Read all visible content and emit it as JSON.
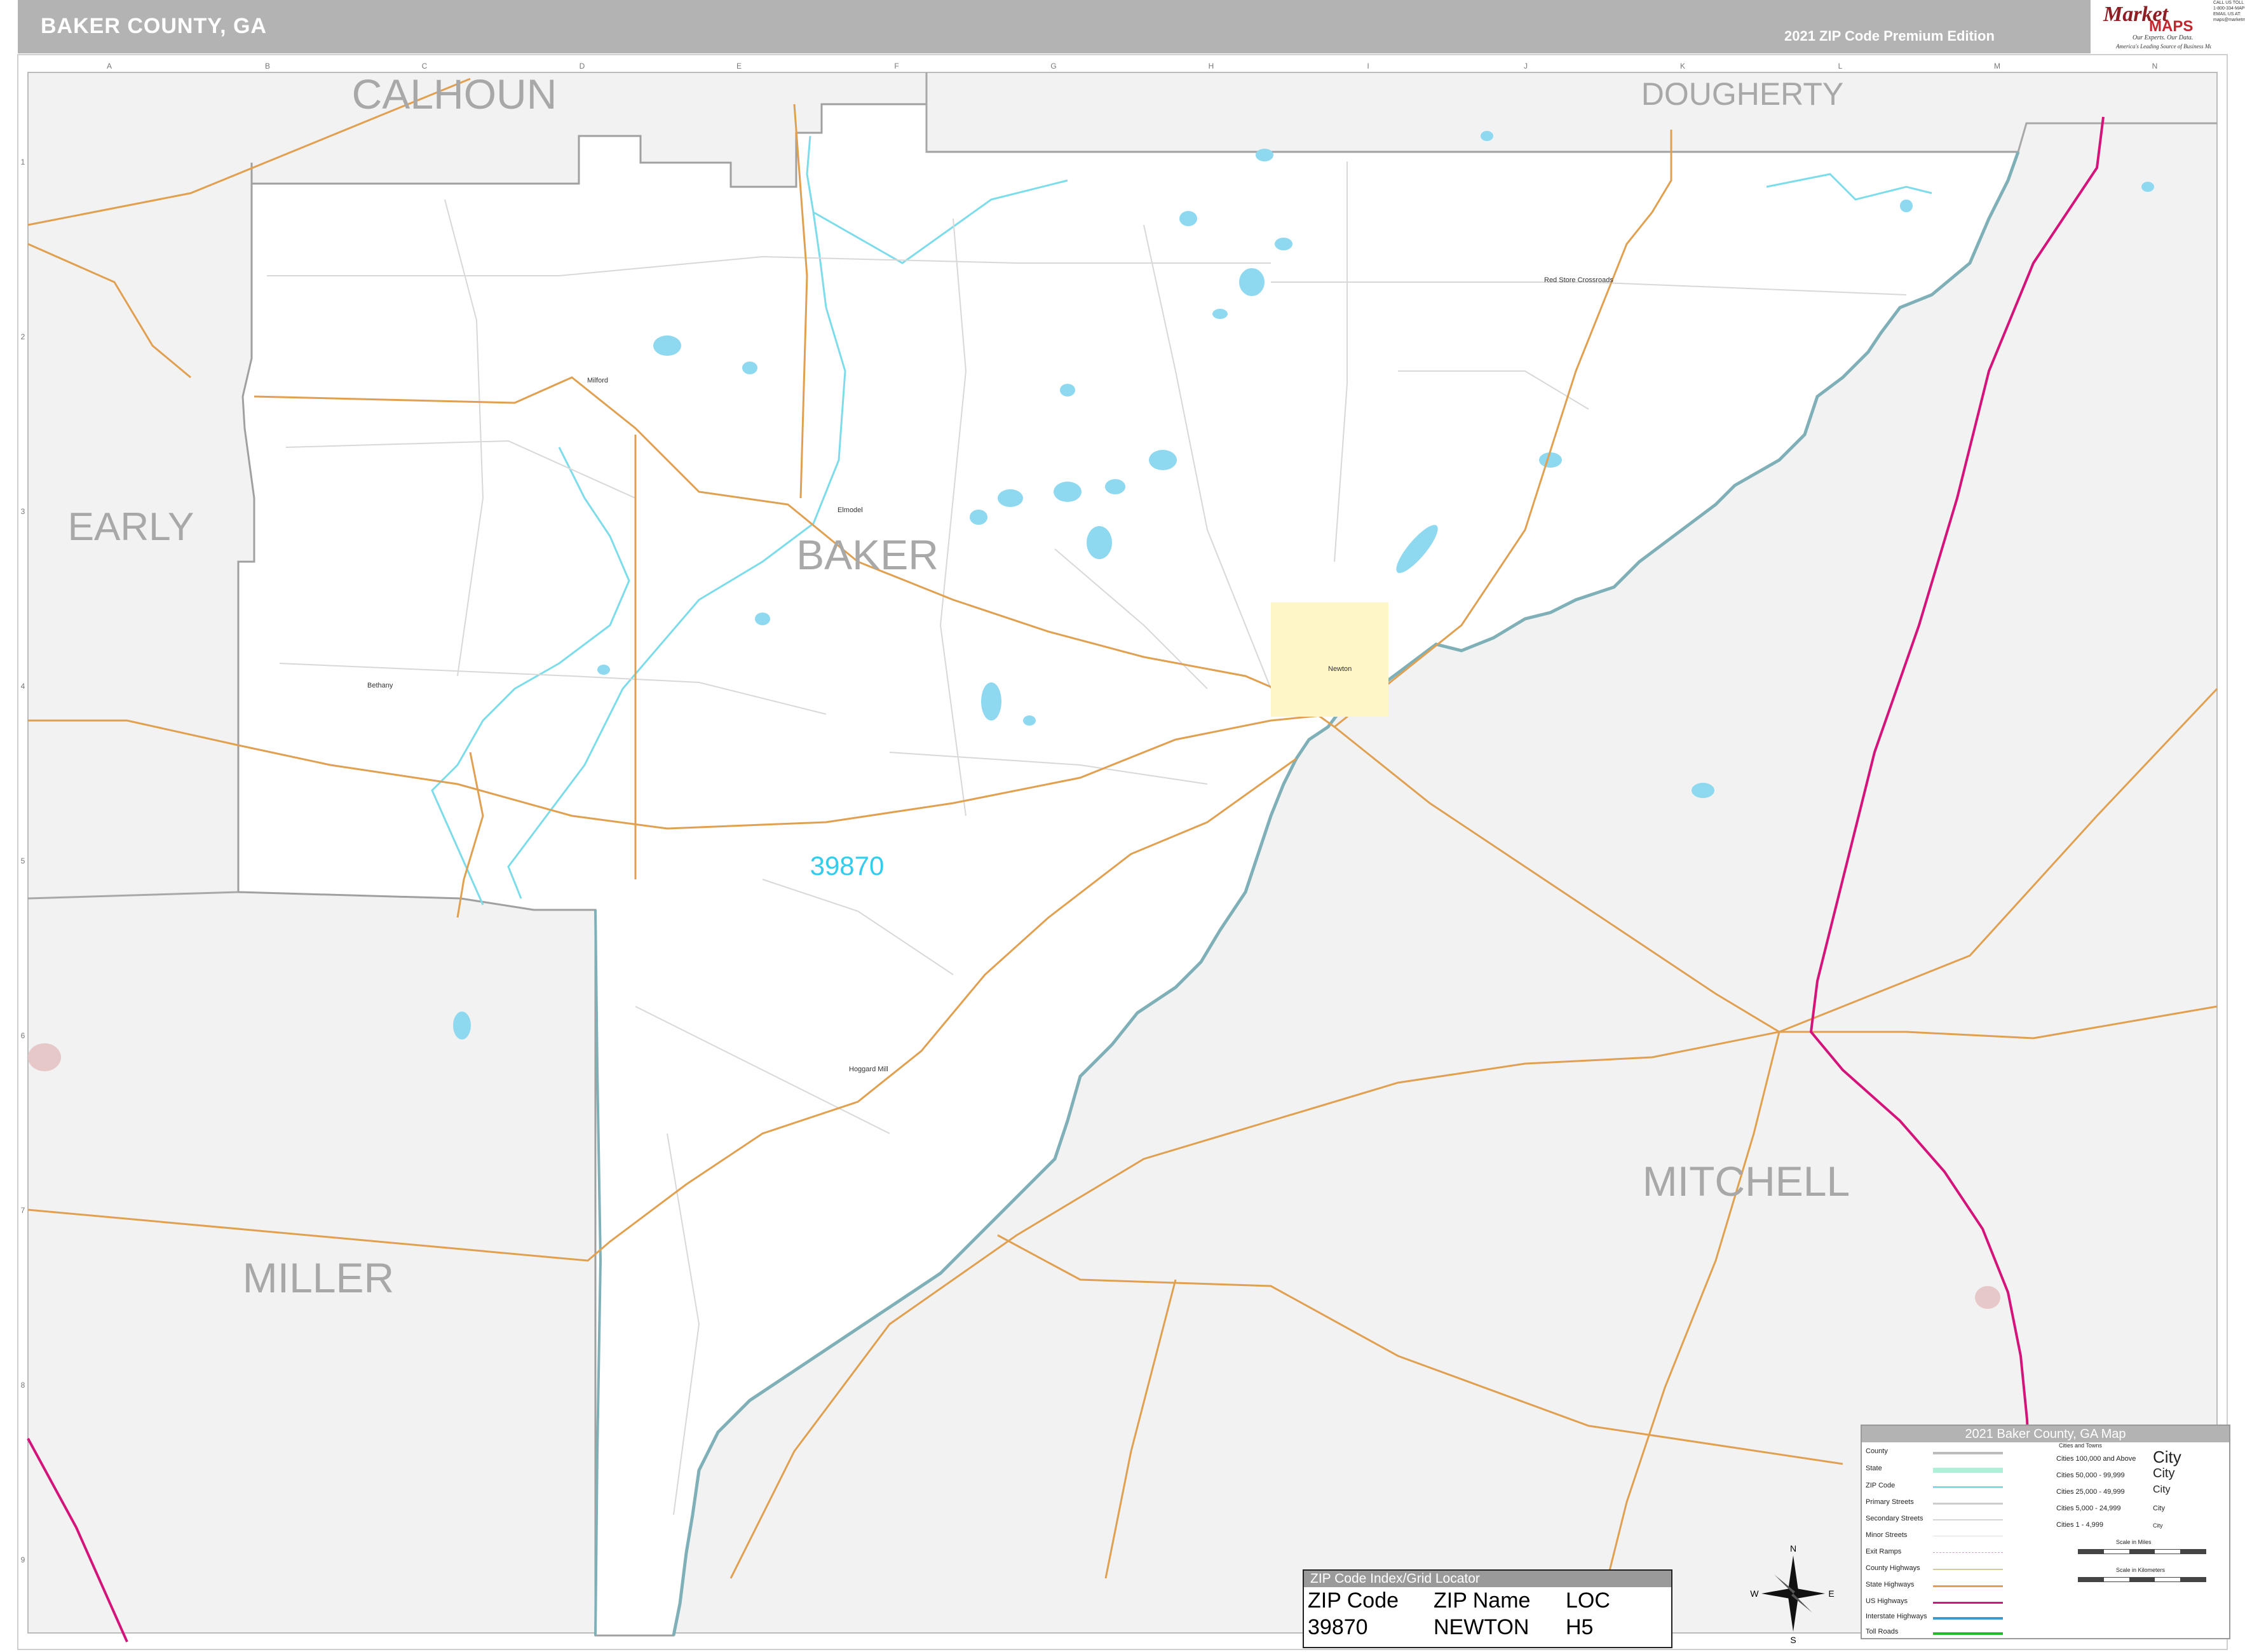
{
  "header": {
    "title": "BAKER COUNTY, GA",
    "edition": "2021 ZIP Code Premium Edition"
  },
  "logo": {
    "top": "Market",
    "bottom": "MAPS",
    "tagline": "Our Experts. Our Data.",
    "tagline2": "America's Leading Source of Business Maps"
  },
  "contact": [
    "CALL US TOLL FREE",
    "1-800-334-MAPS (6277)",
    "EMAIL US AT:",
    "maps@marketmaps.com"
  ],
  "grid": {
    "columns": [
      "A",
      "B",
      "C",
      "D",
      "E",
      "F",
      "G",
      "H",
      "I",
      "J",
      "K",
      "L",
      "M",
      "N"
    ],
    "rows": [
      "1",
      "2",
      "3",
      "4",
      "5",
      "6",
      "7",
      "8",
      "9"
    ]
  },
  "counties": {
    "calhoun": "CALHOUN",
    "dougherty": "DOUGHERTY",
    "early": "EARLY",
    "baker": "BAKER",
    "miller": "MILLER",
    "mitchell": "MITCHELL"
  },
  "zip_label": "39870",
  "places": {
    "milford": "Milford",
    "elmodel": "Elmodel",
    "newton": "Newton",
    "bethany": "Bethany",
    "hoggard_mill": "Hoggard Mill",
    "red_store": "Red Store Crossroads"
  },
  "legend": {
    "title": "2021 Baker County, GA Map",
    "items": [
      "County",
      "State",
      "ZIP Code",
      "Primary Streets",
      "Secondary Streets",
      "Minor Streets",
      "Exit Ramps",
      "County Highways",
      "State Highways",
      "US Highways",
      "Interstate Highways",
      "Toll Roads"
    ],
    "cities_header": "Cities and Towns",
    "cities": [
      {
        "range": "Cities 100,000 and Above",
        "sample": "City"
      },
      {
        "range": "Cities 50,000 - 99,999",
        "sample": "City"
      },
      {
        "range": "Cities 25,000 - 49,999",
        "sample": "City"
      },
      {
        "range": "Cities 5,000 - 24,999",
        "sample": "City"
      },
      {
        "range": "Cities 1 - 4,999",
        "sample": "City"
      }
    ],
    "scale_miles": "Scale in Miles",
    "scale_km": "Scale in Kilometers"
  },
  "zip_index": {
    "title": "ZIP Code Index/Grid Locator",
    "headers": [
      "ZIP Code",
      "ZIP Name",
      "LOC"
    ],
    "rows": [
      [
        "39870",
        "NEWTON",
        "H5"
      ]
    ]
  },
  "compass": {
    "n": "N",
    "s": "S",
    "e": "E",
    "w": "W"
  },
  "colors": {
    "header": "#b3b3b3",
    "outside": "#f2f2f2",
    "county_line": "#a0a0a0",
    "zip_line": "#7ddcea",
    "water": "#8ed8f0",
    "river": "#7fb0b8",
    "state_hwy": "#e0a050",
    "interstate": "#d4147a",
    "city_fill": "#fff6c8"
  }
}
